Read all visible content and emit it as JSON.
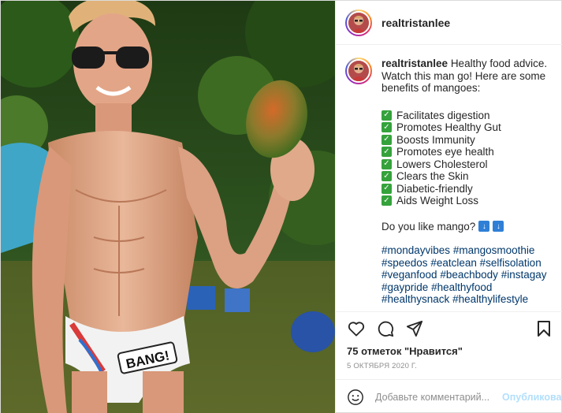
{
  "header": {
    "username": "realtristanlee"
  },
  "caption": {
    "username": "realtristanlee",
    "intro": "Healthy food advice. Watch this man go! Here are some benefits of mangoes:",
    "benefits": [
      "Facilitates digestion",
      "Promotes Healthy Gut",
      "Boosts Immunity",
      "Promotes eye health",
      "Lowers Cholesterol",
      "Clears the Skin",
      "Diabetic-friendly",
      "Aids Weight Loss"
    ],
    "question": "Do you like mango?",
    "question_emoji": "arrow-down-emoji",
    "hashtags": [
      "#mondayvibes",
      "#mangosmoothie",
      "#speedos",
      "#eatclean",
      "#selfisolation",
      "#veganfood",
      "#beachbody",
      "#instagay",
      "#gaypride",
      "#healthyfood",
      "#healthysnack",
      "#healthylifestyle"
    ]
  },
  "photo": {
    "brief_text": "BANG!"
  },
  "actions": {
    "icons": [
      "heart-icon",
      "comment-icon",
      "share-icon",
      "bookmark-icon"
    ]
  },
  "likes": "75 отметок \"Нравится\"",
  "date": "5 ОКТЯБРЯ 2020 Г.",
  "comment": {
    "placeholder": "Добавьте комментарий...",
    "publish_label": "Опубликовать"
  },
  "colors": {
    "link": "#00376b",
    "check": "#35a23b",
    "publish_disabled": "#b2dffc"
  }
}
